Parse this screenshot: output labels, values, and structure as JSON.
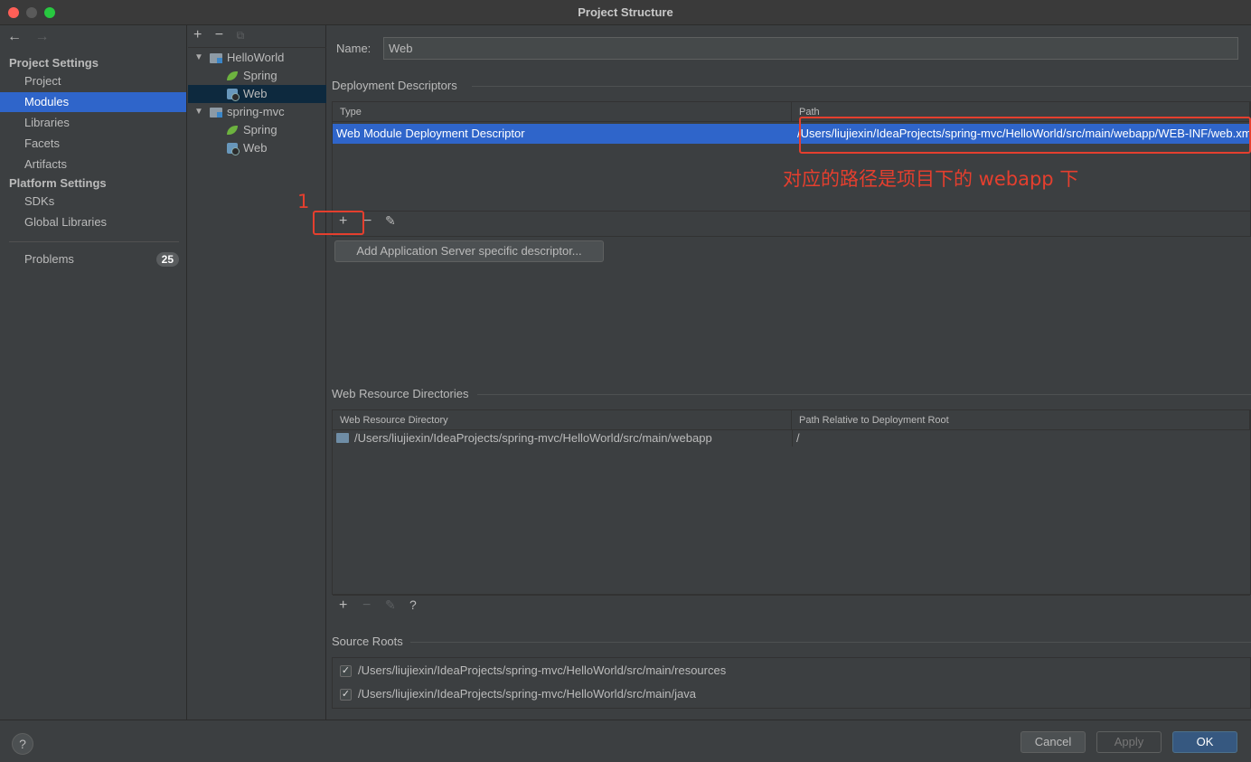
{
  "window": {
    "title": "Project Structure"
  },
  "nav": {
    "back": "←",
    "forward": "→"
  },
  "sidebar": {
    "project_settings_title": "Project Settings",
    "items": [
      {
        "label": "Project"
      },
      {
        "label": "Modules"
      },
      {
        "label": "Libraries"
      },
      {
        "label": "Facets"
      },
      {
        "label": "Artifacts"
      }
    ],
    "platform_settings_title": "Platform Settings",
    "platform_items": [
      {
        "label": "SDKs"
      },
      {
        "label": "Global Libraries"
      }
    ],
    "problems": {
      "label": "Problems",
      "count": "25"
    }
  },
  "tree": {
    "toolbar": {
      "add": "+",
      "remove": "−",
      "copy": "⧉"
    },
    "nodes": [
      {
        "label": "HelloWorld"
      },
      {
        "label": "Spring"
      },
      {
        "label": "Web"
      },
      {
        "label": "spring-mvc"
      },
      {
        "label": "Spring"
      },
      {
        "label": "Web"
      }
    ]
  },
  "main": {
    "name_label": "Name:",
    "name_value": "Web",
    "deployment": {
      "title": "Deployment Descriptors",
      "col_type": "Type",
      "col_path": "Path",
      "row_type": "Web Module Deployment Descriptor",
      "row_path": "/Users/liujiexin/IdeaProjects/spring-mvc/HelloWorld/src/main/webapp/WEB-INF/web.xml",
      "toolbar": {
        "add": "+",
        "remove": "−",
        "edit": "✎"
      },
      "add_server_button": "Add Application Server specific descriptor..."
    },
    "web_resources": {
      "title": "Web Resource Directories",
      "col_dir": "Web Resource Directory",
      "col_rel": "Path Relative to Deployment Root",
      "row_dir": "/Users/liujiexin/IdeaProjects/spring-mvc/HelloWorld/src/main/webapp",
      "row_rel": "/",
      "toolbar": {
        "add": "+",
        "remove": "−",
        "edit": "✎",
        "help": "?"
      }
    },
    "source_roots": {
      "title": "Source Roots",
      "items": [
        {
          "path": "/Users/liujiexin/IdeaProjects/spring-mvc/HelloWorld/src/main/resources",
          "checked": true
        },
        {
          "path": "/Users/liujiexin/IdeaProjects/spring-mvc/HelloWorld/src/main/java",
          "checked": true
        }
      ]
    }
  },
  "annotations": {
    "number_one": "1",
    "note": "对应的路径是项目下的 webapp 下",
    "color": "#e53f2e"
  },
  "footer": {
    "help": "?",
    "cancel": "Cancel",
    "apply": "Apply",
    "ok": "OK"
  },
  "colors": {
    "accent": "#2f65ca",
    "background": "#3c3f41",
    "ok_button": "#365880"
  }
}
